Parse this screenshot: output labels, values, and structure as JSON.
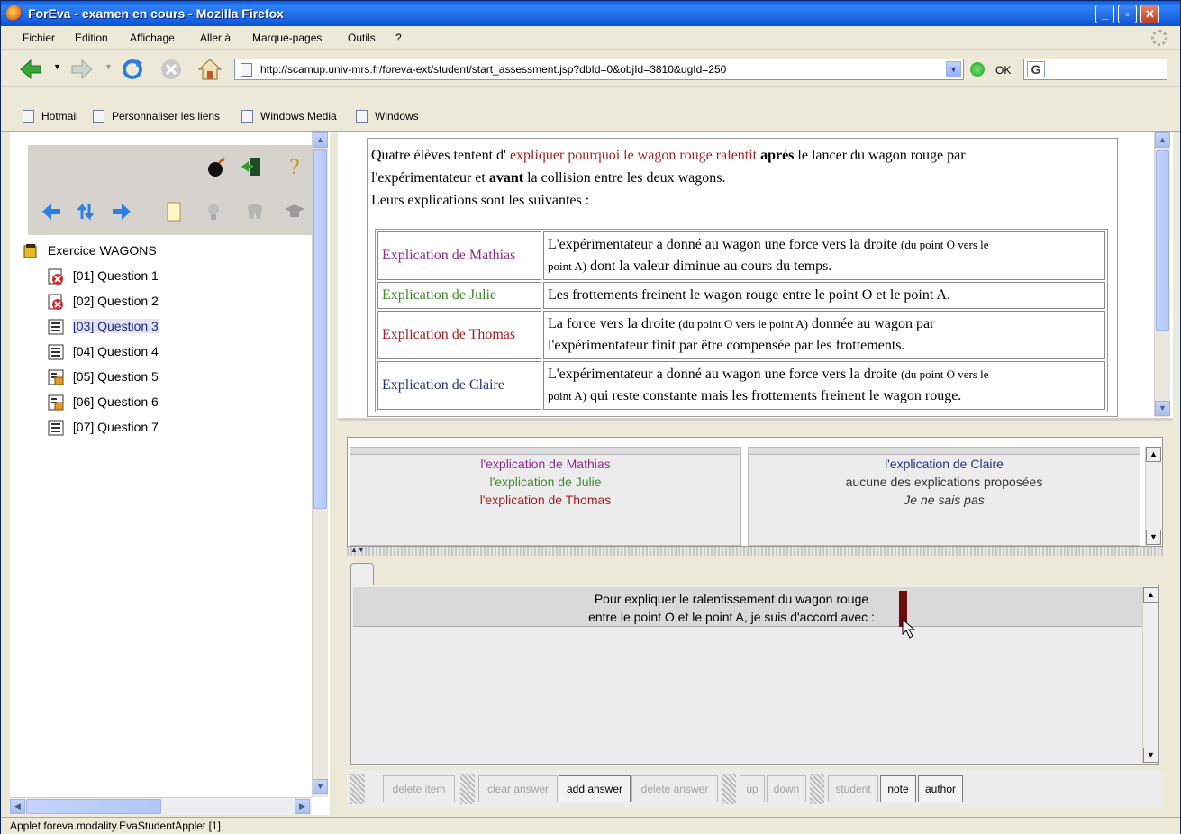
{
  "window": {
    "title": "ForEva - examen en cours - Mozilla Firefox"
  },
  "menu": [
    {
      "label": "Fichier"
    },
    {
      "label": "Edition"
    },
    {
      "label": "Affichage"
    },
    {
      "label": "Aller à"
    },
    {
      "label": "Marque-pages"
    },
    {
      "label": "Outils"
    },
    {
      "label": "?"
    }
  ],
  "nav": {
    "url": "http://scamup.univ-mrs.fr/foreva-ext/student/start_assessment.jsp?dbId=0&objId=3810&ugId=250",
    "go_label": "OK",
    "search_icon_letter": "G"
  },
  "bookmarks": [
    {
      "label": "Hotmail"
    },
    {
      "label": "Personnaliser les liens"
    },
    {
      "label": "Windows Media"
    },
    {
      "label": "Windows"
    }
  ],
  "tree": {
    "root": "Exercice WAGONS",
    "items": [
      {
        "label": "[01] Question 1",
        "icon": "answered-red-icon"
      },
      {
        "label": "[02] Question 2",
        "icon": "answered-red-icon"
      },
      {
        "label": "[03] Question 3",
        "icon": "list-icon",
        "selected": true
      },
      {
        "label": "[04] Question 4",
        "icon": "list-icon"
      },
      {
        "label": "[05] Question 5",
        "icon": "lock-list-icon"
      },
      {
        "label": "[06] Question 6",
        "icon": "lock-list-icon"
      },
      {
        "label": "[07] Question 7",
        "icon": "list-icon"
      }
    ]
  },
  "question": {
    "intro_part1": "Quatre élèves tentent d'",
    "intro_highlight": "expliquer pourquoi le wagon rouge ralentit",
    "intro_bold1": "après",
    "intro_part2": "le lancer du wagon rouge par",
    "intro_line2a": "l'expérimentateur et",
    "intro_bold2": "avant",
    "intro_line2b": "la collision entre les deux wagons.",
    "intro_line3": "Leurs explications sont les suivantes :",
    "rows": [
      {
        "name": "Explication de Mathias",
        "t1": "L'expérimentateur a donné au wagon une force vers la droite",
        "s1": "(du point O vers le",
        "s2": "point A)",
        "t2": "dont la valeur diminue au cours du temps."
      },
      {
        "name": "Explication de Julie",
        "t1": "Les frottements freinent le wagon rouge entre le point O et le point A."
      },
      {
        "name": "Explication de Thomas",
        "t1": "La force vers la droite",
        "s1": "(du point O vers le point A)",
        "t1b": "donnée au wagon par",
        "t2": "l'expérimentateur finit par être compensée par les frottements."
      },
      {
        "name": "Explication de Claire",
        "t1": "L'expérimentateur a donné au wagon une force vers la droite",
        "s1": "(du point O vers le",
        "s2": "point A)",
        "t2": "qui reste constante mais les frottements freinent le wagon rouge."
      }
    ]
  },
  "answers": {
    "left": [
      "l'explication de Mathias",
      "l'explication de Julie",
      "l'explication de Thomas"
    ],
    "right": [
      "l'explication de Claire",
      "aucune des explications proposées",
      "Je ne sais pas"
    ]
  },
  "statement": {
    "line1": "Pour expliquer le ralentissement du wagon rouge",
    "line2": "entre le point O et le point A, je suis d'accord avec :"
  },
  "buttons": {
    "delete_item": "delete item",
    "clear_answer": "clear answer",
    "add_answer": "add answer",
    "delete_answer": "delete answer",
    "up": "up",
    "down": "down",
    "student": "student",
    "note": "note",
    "author": "author"
  },
  "status": "Applet foreva.modality.EvaStudentApplet [1]",
  "colors": {
    "mathias": "#8c2b8c",
    "julie": "#3c8a2a",
    "thomas": "#a42020",
    "claire": "#24347a",
    "title_bar": "#1f6de8"
  }
}
